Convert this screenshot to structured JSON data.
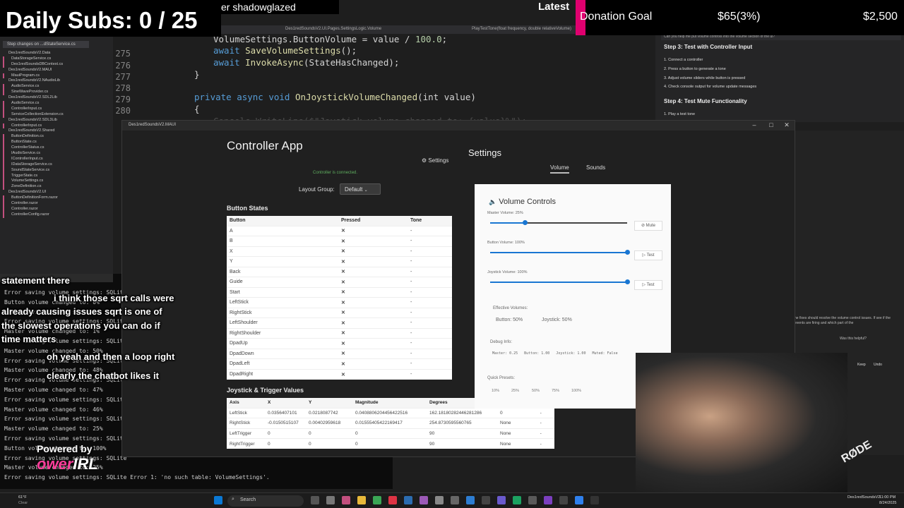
{
  "overlay": {
    "daily_subs": "Daily Subs: 0 / 25",
    "ticker": "er shadowglazed",
    "latest": "Latest",
    "donation_label": "Donation Goal",
    "donation_current": "$65(3%)",
    "donation_target": "$2,500",
    "chat_messages": [
      "statement there",
      "i think those sqrt calls were",
      "already causing issues sqrt is one of",
      "the slowest operations you can do if",
      "time matters",
      "oh yeah and then a loop right",
      "clearly the chatbot likes it"
    ],
    "powered_by": "Powered by",
    "brand_a": "ower",
    "brand_b": "IRL",
    "mic_brand": "RØDE"
  },
  "ide": {
    "tabs": [
      "Des1redSoundsV2.UI.Pages.SettingsLogic.Volume",
      "PlayTestTone(float frequency, double relativeVolume)"
    ],
    "explorer_header": "Step changes on ...dStateService.cs",
    "explorer_items": [
      "Des1redSoundsV2.Data",
      "DataStorageService.cs",
      "Des1redSoundsDBContext.cs",
      "Des1redSoundsV2.MAUI",
      "MauiProgram.cs",
      "Des1redSoundsV2.NAudioLib",
      "AudioService.cs",
      "SineWaveProvider.cs",
      "Des1redSoundsV2.SDL2Lib",
      "AudioService.cs",
      "ControllerInput.cs",
      "ServiceCollectionExtension.cs",
      "Des1redSoundsV2.SDL3Lib",
      "ControllerInput.cs",
      "Des1redSoundsV2.Shared",
      "ButtonDefinition.cs",
      "ButtonState.cs",
      "ControllerStatus.cs",
      "IAudioService.cs",
      "IControllerInput.cs",
      "IDataStorageService.cs",
      "SoundStateService.cs",
      "TriggerState.cs",
      "VolumeSettings.cs",
      "ZoneDefinition.cs",
      "Des1redSoundsV2.UI",
      "ButtonDefinitionForm.razor",
      "Controller.razor",
      "Controller.razor",
      "ControllerConfig.razor"
    ],
    "line_numbers": [
      "275",
      "276",
      "277",
      "278",
      "279",
      "280"
    ],
    "code_lines": [
      {
        "a": "VolumeSettings.ButtonVolume = value / ",
        "b": "100.0",
        "c": ";"
      },
      {
        "a": "await ",
        "b": "SaveVolumeSettings",
        "c": "();"
      },
      {
        "a": "await ",
        "b": "InvokeAsync",
        "c": "(StateHasChanged);"
      },
      {
        "a": "}",
        "b": "",
        "c": ""
      },
      {
        "a": "private async void ",
        "b": "OnJoystickVolumeChanged",
        "c": "(int value)"
      },
      {
        "a": "{",
        "b": "",
        "c": ""
      }
    ],
    "code_partial": "Console.WriteLine($\"Joystick volume changed to: {value}%\");",
    "chat_question": "Can you help me put volume controls into the volume section of the ui?",
    "chat_step3": "Step 3: Test with Controller Input",
    "chat_step3_items": [
      "1. Connect a controller",
      "2. Press a button to generate a tone",
      "3. Adjust volume sliders while button is pressed",
      "4. Check console output for volume update messages"
    ],
    "chat_step4": "Step 4: Test Mute Functionality",
    "chat_step4_items": [
      "1. Play a test tone"
    ],
    "right_note": "he fixes should resolve the volume control issues. If see if the events are firing and which part of the",
    "helpful": "Was this helpful?",
    "keep": "Keep",
    "undo": "Undo"
  },
  "terminal": {
    "lines": [
      "Error saving volume settings: SQLite",
      "Button volume changed to: 0%",
      "Error saving volume settings: SQLite",
      "Error saving volume settings: SQLite",
      "Master volume changed to: 1%",
      "Error saving volume settings: SQLite",
      "Master volume changed to: 50%",
      "Error saving volume settings: SQLite",
      "Master volume changed to: 48%",
      "Error saving volume settings: SQLite",
      "Master volume changed to: 47%",
      "Error saving volume settings: SQLite",
      "Master volume changed to: 46%",
      "Error saving volume settings: SQLite",
      "Master volume changed to: 25%",
      "Error saving volume settings: SQLite",
      "Button volume changed to: 100%",
      "Error saving volume settings: SQLite",
      "Master volume changed to: 25%",
      "Error saving volume settings: SQLite Error 1: 'no such table: VolumeSettings'."
    ]
  },
  "app": {
    "window_title": "Des1redSoundsV2.MAUI",
    "title": "Controller App",
    "settings_link": "Settings",
    "connected": "Controller is connected.",
    "layout_group_label": "Layout Group:",
    "layout_group_value": "Default",
    "button_states_title": "Button States",
    "button_columns": [
      "Button",
      "Pressed",
      "Tone"
    ],
    "buttons": [
      "A",
      "B",
      "X",
      "Y",
      "Back",
      "Guide",
      "Start",
      "LeftStick",
      "RightStick",
      "LeftShoulder",
      "RightShoulder",
      "DpadUp",
      "DpadDown",
      "DpadLeft",
      "DpadRight"
    ],
    "pressed_mark": "✕",
    "tone_value": "-",
    "joystick_title": "Joystick & Trigger Values",
    "joystick_columns": [
      "Axis",
      "X",
      "Y",
      "Magnitude",
      "Degrees"
    ],
    "joystick_rows": [
      {
        "axis": "LeftStick",
        "x": "0.0356407101",
        "y": "0.0218087742",
        "mag": "0.0408806204456422516",
        "deg": "162.18180282446281286",
        "zone": "0",
        "d": "-"
      },
      {
        "axis": "RightStick",
        "x": "-0.0150515107",
        "y": "0.00402959618",
        "mag": "0.01555405422169417",
        "deg": "254.8730595560765",
        "zone": "None",
        "d": "-"
      },
      {
        "axis": "LeftTrigger",
        "x": "0",
        "y": "0",
        "mag": "0",
        "deg": "90",
        "zone": "None",
        "d": "-"
      },
      {
        "axis": "RightTrigger",
        "x": "0",
        "y": "0",
        "mag": "0",
        "deg": "90",
        "zone": "None",
        "d": "-"
      }
    ]
  },
  "settings": {
    "title": "Settings",
    "tabs": [
      "Volume",
      "Sounds"
    ],
    "volume_title": "Volume Controls",
    "master_label": "Master Volume: 25%",
    "master_value": 0.25,
    "mute_label": "Mute",
    "button_label": "Button Volume: 100%",
    "button_value": 1.0,
    "joystick_label": "Joystick Volume: 100%",
    "joystick_value": 1.0,
    "test_label": "Test",
    "effective_title": "Effective Volumes:",
    "effective_button": "Button: 50%",
    "effective_joystick": "Joystick: 50%",
    "debug_title": "Debug Info:",
    "debug_text": "Master: 0.25   Button: 1.00   Joystick: 1.00   Muted: False",
    "presets_title": "Quick Presets:",
    "presets": [
      "10%",
      "25%",
      "50%",
      "75%",
      "100%"
    ]
  },
  "taskbar": {
    "weather": "61°F",
    "weather_desc": "Clear",
    "search": "Search",
    "app_tray": "Des1redSoundsV2",
    "time": "11:00 PM",
    "date": "8/24/2025"
  },
  "colors": {
    "accent": "#1976d2",
    "donation_accent": "#e0006f",
    "error_x": "#e53935"
  }
}
